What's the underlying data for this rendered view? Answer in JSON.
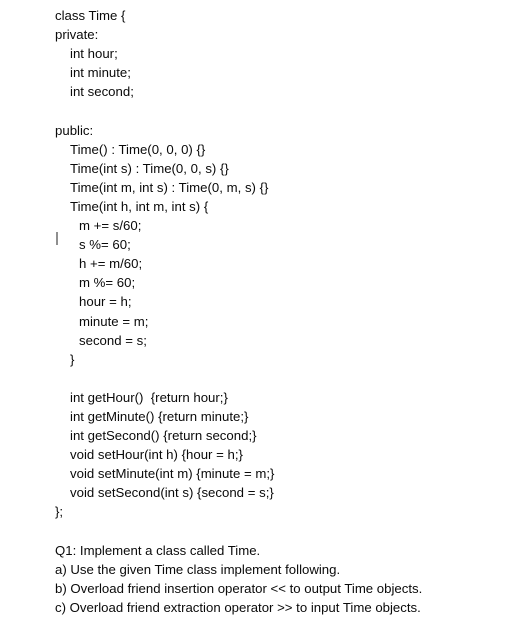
{
  "document": {
    "background_color": "#ffffff",
    "text_color": "#0a0a0a",
    "caret_color": "#8f8f8f"
  },
  "code": {
    "lines": [
      {
        "indent": 0,
        "text": "class Time {"
      },
      {
        "indent": 0,
        "text": "private:"
      },
      {
        "indent": 1,
        "text": "int hour;"
      },
      {
        "indent": 1,
        "text": "int minute;"
      },
      {
        "indent": 1,
        "text": "int second;"
      },
      {
        "indent": 0,
        "text": ""
      },
      {
        "indent": 0,
        "text": "public:"
      },
      {
        "indent": 1,
        "text": "Time() : Time(0, 0, 0) {}"
      },
      {
        "indent": 1,
        "text": "Time(int s) : Time(0, 0, s) {}"
      },
      {
        "indent": 1,
        "text": "Time(int m, int s) : Time(0, m, s) {}"
      },
      {
        "indent": 1,
        "text": "Time(int h, int m, int s) {"
      },
      {
        "indent": 2,
        "text": "m += s/60;"
      },
      {
        "indent": 2,
        "text": "s %= 60;"
      },
      {
        "indent": 2,
        "text": "h += m/60;"
      },
      {
        "indent": 2,
        "text": "m %= 60;"
      },
      {
        "indent": 2,
        "text": "hour = h;"
      },
      {
        "indent": 2,
        "text": "minute = m;"
      },
      {
        "indent": 2,
        "text": "second = s;"
      },
      {
        "indent": 1,
        "text": "}"
      },
      {
        "indent": 0,
        "text": ""
      },
      {
        "indent": 1,
        "text": "int getHour()  {return hour;}"
      },
      {
        "indent": 1,
        "text": "int getMinute() {return minute;}"
      },
      {
        "indent": 1,
        "text": "int getSecond() {return second;}"
      },
      {
        "indent": 1,
        "text": "void setHour(int h) {hour = h;}"
      },
      {
        "indent": 1,
        "text": "void setMinute(int m) {minute = m;}"
      },
      {
        "indent": 1,
        "text": "void setSecond(int s) {second = s;}"
      },
      {
        "indent": 0,
        "text": "};"
      }
    ]
  },
  "question": {
    "lines": [
      "Q1: Implement a class called Time.",
      "a) Use the given Time class implement following.",
      "b) Overload friend insertion operator << to output Time objects.",
      "c) Overload friend extraction operator >> to input Time objects."
    ]
  }
}
